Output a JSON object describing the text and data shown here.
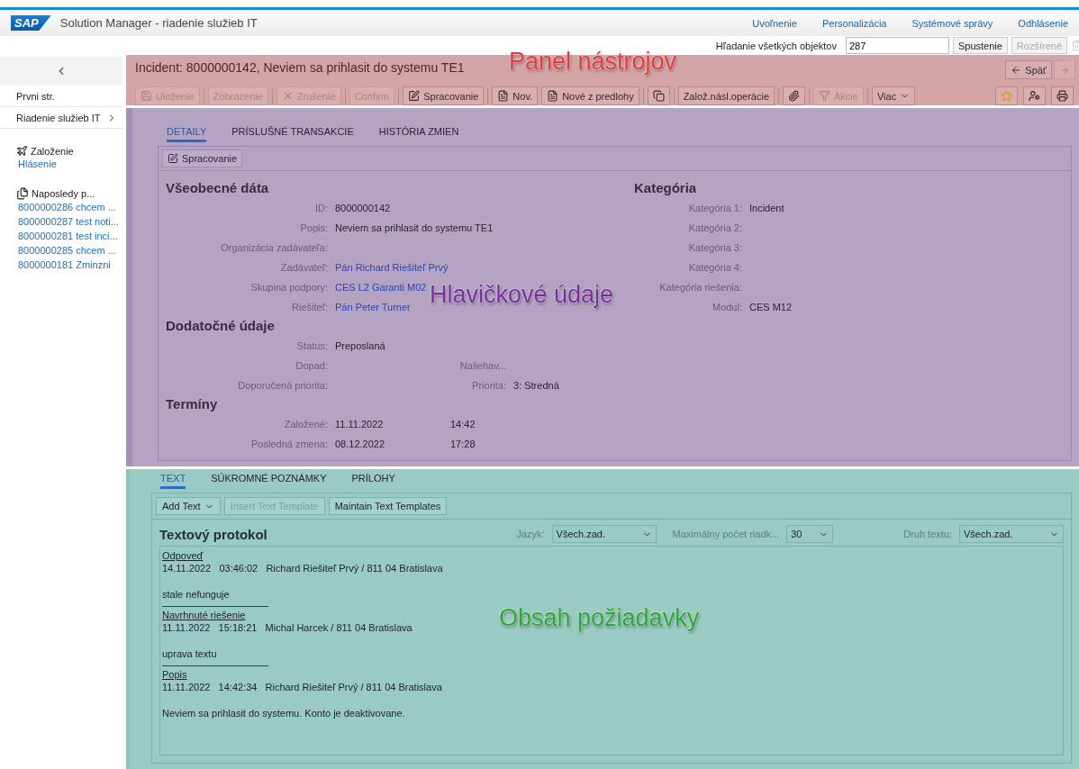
{
  "header": {
    "logo": "SAP",
    "title": "Solution Manager - riadenie služieb IT",
    "links": [
      "Uvoľnenie",
      "Personalizácia",
      "Systémové správy",
      "Odhlásenie"
    ]
  },
  "search": {
    "label": "Hľadanie všetkých objektov",
    "value": "287",
    "buttons": [
      {
        "label": "Spustenie",
        "disabled": false
      },
      {
        "label": "Rozšírené",
        "disabled": true
      }
    ]
  },
  "sidebar": {
    "nav": [
      {
        "label": "Prvni str.",
        "expandable": false
      },
      {
        "label": "Riadenie služieb IT",
        "expandable": true
      }
    ],
    "create": {
      "title": "Založenie",
      "links": [
        "Hlásenie"
      ]
    },
    "recent": {
      "title": "Naposledy p...",
      "items": [
        "8000000286 chcem ...",
        "8000000287 test noti...",
        "8000000281 test inci...",
        "8000000285 chcem ...",
        "8000000181 Zminzni"
      ]
    }
  },
  "object": {
    "title": "Incident: 8000000142, Neviem sa prihlasit do systemu TE1",
    "back": "Späť",
    "annotation": {
      "label": "Panel nástrojov",
      "color": "#e8383d"
    },
    "toolbar": [
      {
        "kind": "text",
        "label": "Uloženie",
        "disabled": true
      },
      {
        "kind": "text",
        "label": "Zobrazenie",
        "disabled": true
      },
      {
        "kind": "text",
        "label": "Zrušenie",
        "disabled": true
      },
      {
        "kind": "text",
        "label": "Confirm",
        "disabled": true
      },
      {
        "kind": "text",
        "label": "Spracovanie",
        "disabled": false
      },
      {
        "kind": "text",
        "label": "Nov.",
        "disabled": false
      },
      {
        "kind": "text",
        "label": "Nové z predlohy",
        "disabled": false
      },
      {
        "kind": "icon",
        "disabled": false
      },
      {
        "kind": "text",
        "label": "Založ.násl.operácie",
        "disabled": false
      },
      {
        "kind": "icon",
        "disabled": false
      },
      {
        "kind": "text",
        "label": "Akcie",
        "disabled": true
      },
      {
        "kind": "menu",
        "label": "Viac",
        "disabled": false
      }
    ]
  },
  "details": {
    "annotation": {
      "label": "Hlavičkové údaje",
      "color": "#7a2fa0"
    },
    "tabs": [
      {
        "label": "DETAILY",
        "selected": true
      },
      {
        "label": "PRÍSLUŠNÉ TRANSAKCIE",
        "selected": false
      },
      {
        "label": "HISTÓRIA ZMIEN",
        "selected": false
      }
    ],
    "edit_button": "Spracovanie",
    "sections": [
      {
        "title": "Všeobecné dáta",
        "fields": [
          {
            "label": "ID:",
            "value": "8000000142",
            "link": false
          },
          {
            "label": "Popis:",
            "value": "Neviem sa prihlasit do systemu TE1",
            "link": false
          },
          {
            "label": "Organizácia zadávateľa:"
          },
          {
            "label": "Zadávateľ:",
            "value": "Pán Richard Riešiteľ Prvý",
            "link": true
          },
          {
            "label": "Skupina podpory:",
            "value": "CES L2 Garanti M02",
            "link": true
          },
          {
            "label": "Riešiteľ:",
            "value": "Pán Peter Turner",
            "link": true
          }
        ]
      },
      {
        "title": "Dodatočné údaje",
        "fields": [
          {
            "label": "Status:",
            "value": "Preposlaná",
            "link": false
          },
          {
            "label": "Dopad:",
            "label2": "Naliehav..."
          },
          {
            "label": "Doporučená priorita:",
            "label2": "Priorita:",
            "value2": "3: Stredná"
          }
        ]
      },
      {
        "title": "Termíny",
        "fields": [
          {
            "label": "Založené:",
            "value": "11.11.2022",
            "link": false,
            "time": "14:42"
          },
          {
            "label": "Posledná zmena:",
            "value": "08.12.2022",
            "link": false,
            "time": "17:28"
          }
        ]
      }
    ],
    "category": {
      "title": "Kategória",
      "fields": [
        {
          "label": "Kategória 1:",
          "value": "Incident"
        },
        {
          "label": "Kategória 2:"
        },
        {
          "label": "Kategória 3:"
        },
        {
          "label": "Kategória 4:"
        },
        {
          "label": "Kategória riešenia:"
        },
        {
          "label": "Modul:",
          "value": "CES M12"
        }
      ]
    }
  },
  "texts": {
    "annotation": {
      "label": "Obsah požiadavky",
      "color": "#2aa83a"
    },
    "tabs": [
      {
        "label": "TEXT",
        "selected": true
      },
      {
        "label": "SÚKROMNÉ POZNÁMKY",
        "selected": false
      },
      {
        "label": "PRÍLOHY",
        "selected": false
      }
    ],
    "buttons": [
      {
        "label": "Add Text",
        "kind": "menu",
        "disabled": false
      },
      {
        "label": "Insert Text Template",
        "kind": "button",
        "disabled": true
      },
      {
        "label": "Maintain Text Templates",
        "kind": "button",
        "disabled": false
      }
    ],
    "title": "Textový protokol",
    "filters": [
      {
        "label": "Jazyk:",
        "value": "Všech.zad."
      },
      {
        "label": "Maximálny počet riadk...",
        "value": "30"
      },
      {
        "label": "Druh textu:",
        "value": "Všech.zad."
      }
    ],
    "entries": [
      {
        "type": "Odpoveď",
        "date": "14.11.2022",
        "time": "03:46:02",
        "author": "Richard Riešiteľ Prvý / 811 04 Bratislava",
        "body": "stale nefunguje"
      },
      {
        "type": "Navrhnuté riešenie",
        "date": "11.11.2022",
        "time": "15:18:21",
        "author": "Michal Harcek / 811 04 Bratislava",
        "body": "uprava textu"
      },
      {
        "type": "Popis",
        "date": "11.11.2022",
        "time": "14:42:34",
        "author": "Richard Riešiteľ Prvý / 811 04 Bratislava",
        "body": "Neviem sa prihlasit do systemu. Konto je deaktivovane."
      }
    ]
  }
}
